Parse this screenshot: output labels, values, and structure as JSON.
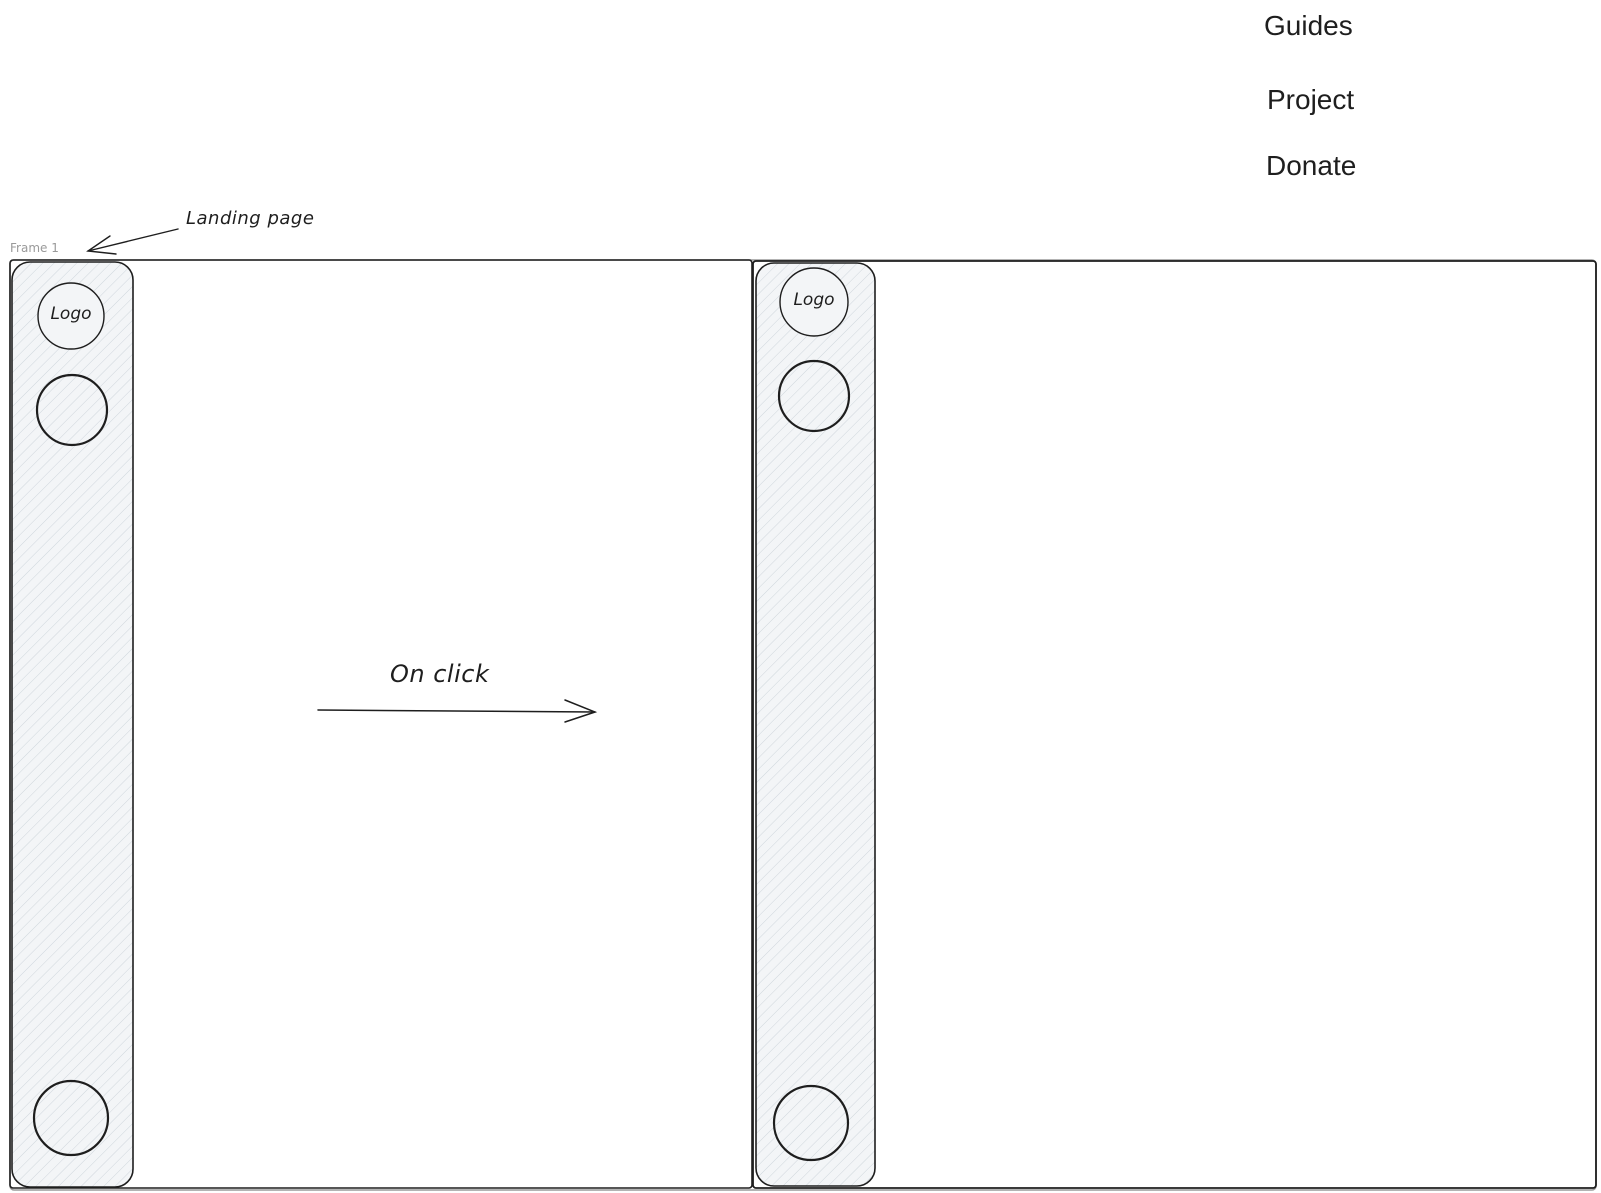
{
  "menu": {
    "items": [
      "Guides",
      "Project",
      "Donate"
    ]
  },
  "frame": {
    "caption": "Frame 1"
  },
  "annotations": {
    "landing_page": "Landing page",
    "on_click": "On click"
  },
  "left_screen": {
    "sidebar": {
      "logo_label": "Logo"
    }
  },
  "right_screen": {
    "sidebar": {
      "logo_label": "Logo"
    }
  },
  "colors": {
    "stroke": "#1e1e1e",
    "frame_border": "#9a9a9a",
    "sidebar_fill": "#f3f5f7",
    "caption": "#9a9a9a"
  },
  "icons": [
    "circle-nav-icon",
    "arrow-icon"
  ]
}
